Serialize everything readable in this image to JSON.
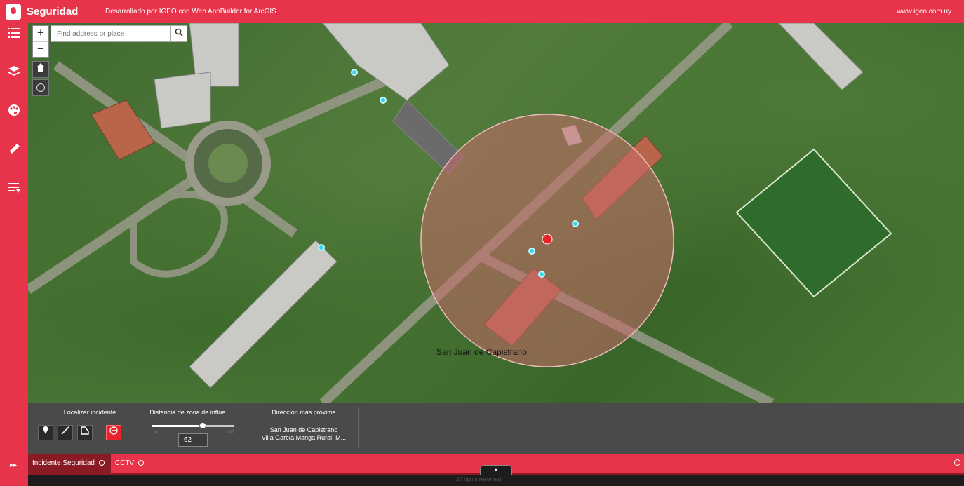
{
  "header": {
    "title": "Seguridad",
    "subtitle": "Desarrollado por IGEO con Web AppBuilder for ArcGIS",
    "url": "www.igeo.com.uy"
  },
  "left_toolbar": {
    "icons": [
      "list-icon",
      "layers-icon",
      "palette-icon",
      "ruler-icon",
      "legend-icon"
    ],
    "expand_label": "▸▸"
  },
  "map": {
    "zoom_in": "+",
    "zoom_out": "−",
    "search": {
      "placeholder": "Find address or place"
    },
    "place_label": "San Juan de Capistrano",
    "buffer_color": "#c96a6a"
  },
  "panel": {
    "col1_title": "Localizar incidente",
    "col2_title": "Distancia de zona de influe...",
    "slider_min": "0",
    "slider_max": "100",
    "slider_value": 62,
    "distance_value": "62",
    "col3_title": "Dirección más próxima",
    "address_line1": "San Juan de Capistrano",
    "address_line2": "Villa García Manga Rural, M..."
  },
  "tabs": [
    {
      "label": "Incidente Seguridad",
      "active": true
    },
    {
      "label": "CCTV",
      "active": false
    }
  ],
  "bottom_strip_text": "20 rights reserved",
  "colors": {
    "brand": "#e8344a",
    "panel": "#4a4a4a",
    "point": "#35d6e8"
  }
}
